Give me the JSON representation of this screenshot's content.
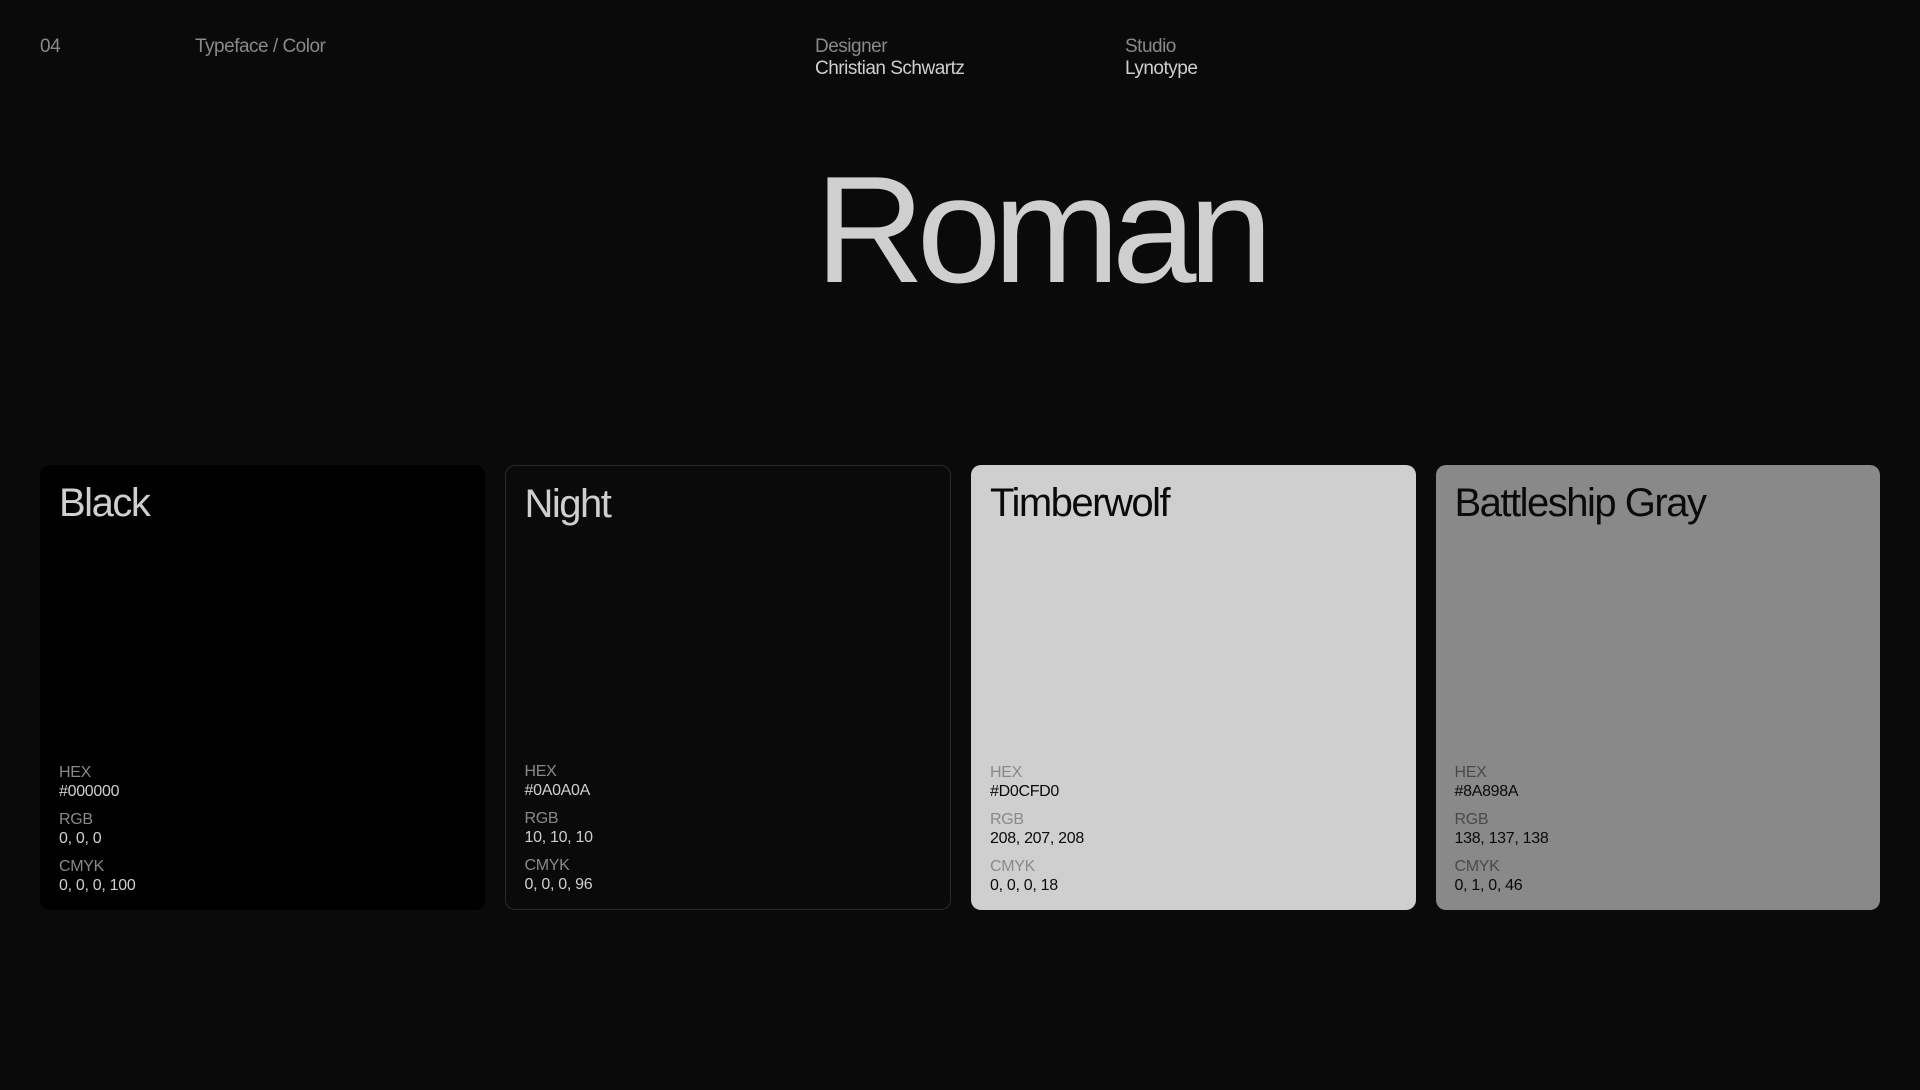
{
  "header": {
    "page_number": "04",
    "section": "Typeface / Color",
    "designer_label": "Designer",
    "designer_value": "Christian Schwartz",
    "studio_label": "Studio",
    "studio_value": "Lynotype"
  },
  "hero": {
    "title": "Roman"
  },
  "colors": [
    {
      "name": "Black",
      "hex_label": "HEX",
      "hex": "#000000",
      "rgb_label": "RGB",
      "rgb": "0, 0, 0",
      "cmyk_label": "CMYK",
      "cmyk": "0, 0, 0, 100",
      "swatch": "#000000"
    },
    {
      "name": "Night",
      "hex_label": "HEX",
      "hex": "#0A0A0A",
      "rgb_label": "RGB",
      "rgb": "10, 10, 10",
      "cmyk_label": "CMYK",
      "cmyk": "0, 0, 0, 96",
      "swatch": "#0A0A0A"
    },
    {
      "name": "Timberwolf",
      "hex_label": "HEX",
      "hex": "#D0CFD0",
      "rgb_label": "RGB",
      "rgb": "208, 207, 208",
      "cmyk_label": "CMYK",
      "cmyk": "0, 0, 0, 18",
      "swatch": "#D0CFD0"
    },
    {
      "name": "Battleship Gray",
      "hex_label": "HEX",
      "hex": "#8A898A",
      "rgb_label": "RGB",
      "rgb": "138, 137, 138",
      "cmyk_label": "CMYK",
      "cmyk": "0, 1, 0, 46",
      "swatch": "#8A898A"
    }
  ]
}
